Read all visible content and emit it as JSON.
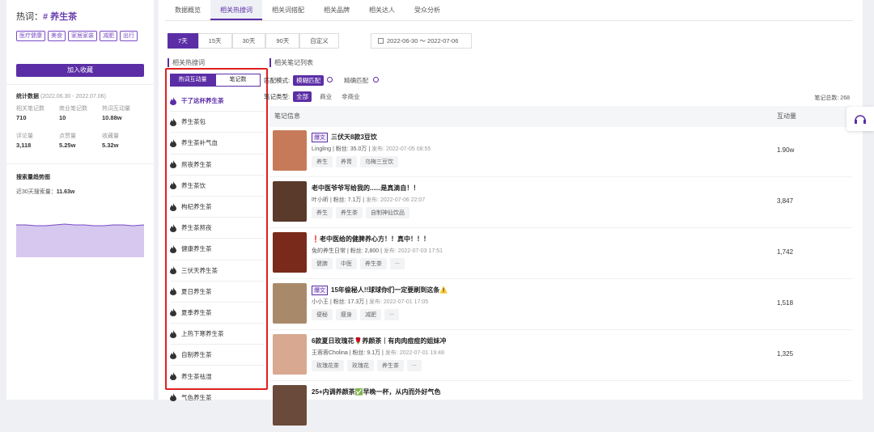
{
  "sidebar": {
    "keyword_label": "热词：",
    "keyword_value": "# 养生茶",
    "tags": [
      "医疗健康",
      "美食",
      "家居家装",
      "减肥",
      "出行"
    ],
    "favorite_button": "加入收藏",
    "stats_title": "统计数据",
    "stats_range": "(2022.06.30 - 2022.07.06)",
    "stats": [
      {
        "label": "相关笔记数",
        "value": "710"
      },
      {
        "label": "商业笔记数",
        "value": "10"
      },
      {
        "label": "热词互动量",
        "value": "10.88w"
      },
      {
        "label": "评论量",
        "value": "3,118"
      },
      {
        "label": "点赞量",
        "value": "5.25w"
      },
      {
        "label": "收藏量",
        "value": "5.32w"
      }
    ],
    "trend_title": "搜索量趋势图",
    "trend_sub_label": "近30天搜索量：",
    "trend_sub_value": "11.63w",
    "colors": {
      "accent": "#5b2ea6",
      "area": "#c9b6ea",
      "line": "#7a4cc5"
    }
  },
  "main": {
    "tabs": [
      {
        "label": "数据概览",
        "active": false
      },
      {
        "label": "相关热搜词",
        "active": true
      },
      {
        "label": "相关词搭配",
        "active": false
      },
      {
        "label": "相关品牌",
        "active": false
      },
      {
        "label": "相关达人",
        "active": false
      },
      {
        "label": "受众分析",
        "active": false
      }
    ],
    "date_buttons": [
      {
        "label": "7天",
        "active": true
      },
      {
        "label": "15天",
        "active": false
      },
      {
        "label": "30天",
        "active": false
      },
      {
        "label": "90天",
        "active": false
      },
      {
        "label": "自定义",
        "active": false
      }
    ],
    "date_range": "2022-06-30 ～ 2022-07-06",
    "hot_section_title": "相关热搜词",
    "notes_section_title": "相关笔记列表",
    "hot_tabs": [
      {
        "label": "热词互动量",
        "active": true
      },
      {
        "label": "笔记数",
        "active": false
      }
    ],
    "hot_words": [
      "干了这杯养生茶",
      "养生茶包",
      "养生茶补气血",
      "熬夜养生茶",
      "养生茶饮",
      "枸杞养生茶",
      "养生茶熬夜",
      "健康养生茶",
      "三伏天养生茶",
      "夏日养生茶",
      "夏季养生茶",
      "上热下寒养生茶",
      "自制养生茶",
      "养生茶祛湿",
      "气色养生茶"
    ],
    "match_label": "匹配模式:",
    "match_active": "模糊匹配",
    "match_other": "精确匹配",
    "type_label": "笔记类型:",
    "type_active": "全部",
    "type_opts": [
      "商业",
      "非商业"
    ],
    "total_label": "笔记总数: 268",
    "col_note": "笔记信息",
    "col_inter": "互动量",
    "notes": [
      {
        "badge": "爆文",
        "title": "三伏天8款3豆饮",
        "author": "Lingling",
        "fans": "粉丝: 35.0万",
        "date": "发布: 2022-07-05 08:55",
        "tags": [
          "养生",
          "养胃",
          "乌梅三豆饮"
        ],
        "inter": "1.90w"
      },
      {
        "badge": "",
        "title": "老中医爷爷写给我的......是真滴自！！",
        "author": "叶小昕",
        "fans": "粉丝: 7.1万",
        "date": "发布: 2022-07-06 22:07",
        "tags": [
          "养生",
          "养生茶",
          "自制神仙饮品"
        ],
        "inter": "3,847"
      },
      {
        "badge": "",
        "title": "❗老中医给的健脾养心方！！真中！！！",
        "author": "免的养生日常",
        "fans": "粉丝: 2,800",
        "date": "发布: 2022-07-03 17:51",
        "tags": [
          "健脾",
          "中医",
          "养生茶",
          "..."
        ],
        "inter": "1,742"
      },
      {
        "badge": "爆文",
        "title": "15年偷秘人!!球球你们一定要刷到这条⚠️",
        "author": "小小王",
        "fans": "粉丝: 17.3万",
        "date": "发布: 2022-07-01 17:05",
        "tags": [
          "便秘",
          "瘦身",
          "减肥",
          "..."
        ],
        "inter": "1,518"
      },
      {
        "badge": "",
        "title": "6款夏日玫瑰花🌹养颜茶｜有肉肉痘痘的姐妹冲",
        "author": "王蓉蓉Cholina",
        "fans": "粉丝: 9.1万",
        "date": "发布: 2022-07-01 19:48",
        "tags": [
          "玫瑰花茶",
          "玫瑰花",
          "养生茶",
          "..."
        ],
        "inter": "1,325"
      },
      {
        "badge": "",
        "title": "25+内调养颜茶✅早晚一杯，从内而外好气色",
        "author": "",
        "fans": "",
        "date": "",
        "tags": [],
        "inter": ""
      }
    ]
  }
}
